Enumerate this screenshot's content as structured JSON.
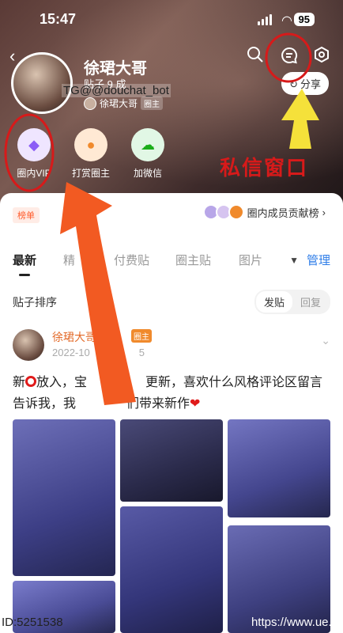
{
  "status": {
    "time": "15:47",
    "battery": "95"
  },
  "header": {
    "title": "徐珺大哥",
    "stats": "贴子 9  成",
    "watermark": "TG@@douchat_bot",
    "owner_name": "徐珺大哥",
    "owner_badge": "圈主",
    "share_label": "分享"
  },
  "features": [
    {
      "label": "圈内VIP",
      "icon": "diamond-icon"
    },
    {
      "label": "打赏圈主",
      "icon": "reward-icon"
    },
    {
      "label": "加微信",
      "icon": "wechat-icon"
    }
  ],
  "annotation": {
    "label": "私信窗口"
  },
  "board": {
    "rank_tag": "榜单",
    "contrib_label": "圈内成员贡献榜"
  },
  "tabs": [
    "最新",
    "精",
    "付费贴",
    "圈主贴",
    "图片"
  ],
  "manage_label": "管理",
  "sort": {
    "label": "贴子排序",
    "options": [
      "发贴",
      "回复"
    ],
    "selected": "发贴"
  },
  "post": {
    "author": "徐珺大哥",
    "tag": "圈主",
    "date": "2022-10",
    "date_tail": "5",
    "text_a": "新",
    "text_b": "放入，宝",
    "text_c": "更新，喜欢什么风格评论区留言告诉我，我",
    "text_d": "们带来新作"
  },
  "footer": {
    "left": "ID:5251538",
    "right": "https://www.ue..."
  },
  "colors": {
    "accent": "#2f7ee8",
    "annotation": "#d71a1a",
    "arrow": "#f25a22",
    "highlight": "#f5e13a"
  }
}
